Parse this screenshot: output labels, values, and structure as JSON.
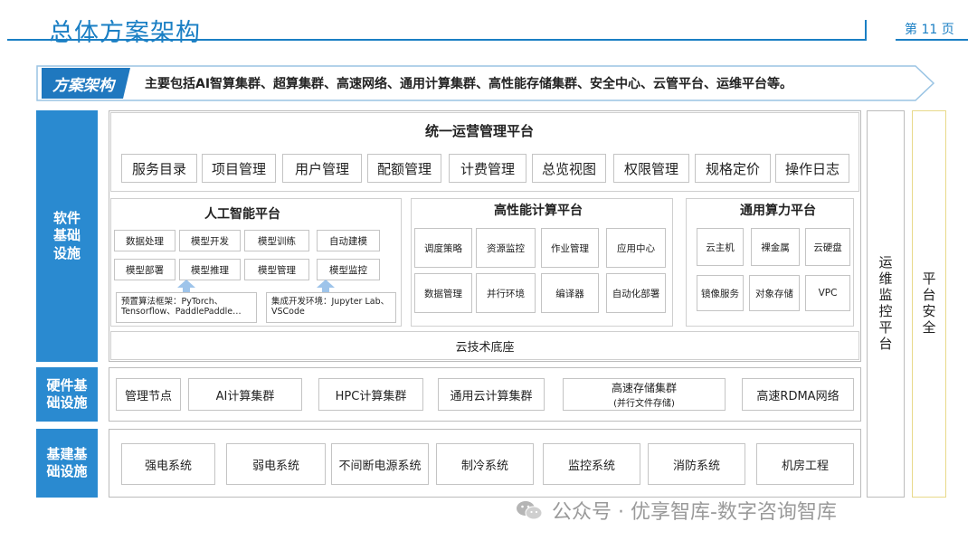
{
  "header": {
    "title": "总体方案架构",
    "page_number": "第 11 页"
  },
  "banner": {
    "label": "方案架构",
    "text": "主要包括AI智算集群、超算集群、高速网络、通用计算集群、高性能存储集群、安全中心、云管平台、运维平台等。"
  },
  "layers": {
    "software": "软件\n基础\n设施",
    "hardware": "硬件基\n础设施",
    "facility": "基建基\n础设施"
  },
  "ops_platform": {
    "title": "统一运营管理平台",
    "items": [
      "服务目录",
      "项目管理",
      "用户管理",
      "配额管理",
      "计费管理",
      "总览视图",
      "权限管理",
      "规格定价",
      "操作日志"
    ]
  },
  "ai_platform": {
    "title": "人工智能平台",
    "items": [
      "数据处理",
      "模型开发",
      "模型训练",
      "自动建模",
      "模型部署",
      "模型推理",
      "模型管理",
      "模型监控"
    ],
    "note_left": "预置算法框架：PyTorch、Tensorflow、PaddlePaddle…",
    "note_right": "集成开发环境：Jupyter Lab、VSCode"
  },
  "hpc_platform": {
    "title": "高性能计算平台",
    "items": [
      "调度策略",
      "资源监控",
      "作业管理",
      "应用中心",
      "数据管理",
      "并行环境",
      "编译器",
      "自动化部署"
    ]
  },
  "general_platform": {
    "title": "通用算力平台",
    "items": [
      "云主机",
      "裸金属",
      "云硬盘",
      "镜像服务",
      "对象存储",
      "VPC"
    ]
  },
  "cloud_base": "云技术底座",
  "hardware_items": [
    "管理节点",
    "AI计算集群",
    "HPC计算集群",
    "通用云计算集群"
  ],
  "storage_item": {
    "line1": "高速存储集群",
    "line2": "(并行文件存储)"
  },
  "rdma_item": "高速RDMA网络",
  "facility_items": [
    "强电系统",
    "弱电系统",
    "不间断电源系统",
    "制冷系统",
    "监控系统",
    "消防系统",
    "机房工程"
  ],
  "right_columns": {
    "ops": "运维监控平台",
    "security": "平台安全"
  },
  "watermark": "公众号 · 优享智库-数字咨询智库",
  "colors": {
    "accent": "#1a7fc4",
    "label_fill": "#2a8ad0",
    "security_border": "#e8d98a"
  }
}
